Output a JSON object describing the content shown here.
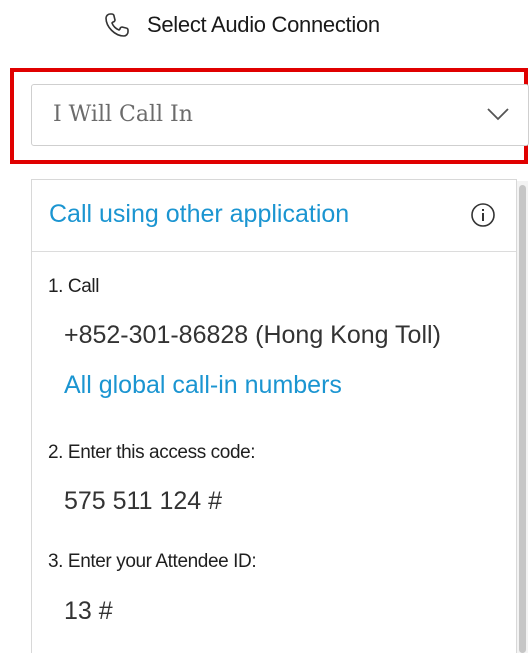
{
  "header": {
    "icon": "phone-icon",
    "title": "Select Audio Connection"
  },
  "audio_select": {
    "selected": "I Will Call In",
    "icon": "chevron-down-icon",
    "highlight_color": "#e00000"
  },
  "panel": {
    "other_app_link": "Call using other application",
    "info_icon": "info-icon",
    "steps": [
      {
        "label": "1. Call",
        "value": "+852-301-86828 (Hong Kong Toll)"
      },
      {
        "label": "2. Enter this access code:",
        "value": "575 511 124 #"
      },
      {
        "label": "3. Enter your Attendee ID:",
        "value": "13 #"
      }
    ],
    "global_numbers_link": "All global call-in numbers"
  },
  "colors": {
    "link": "#1b95d1",
    "border": "#cfcfcf"
  }
}
